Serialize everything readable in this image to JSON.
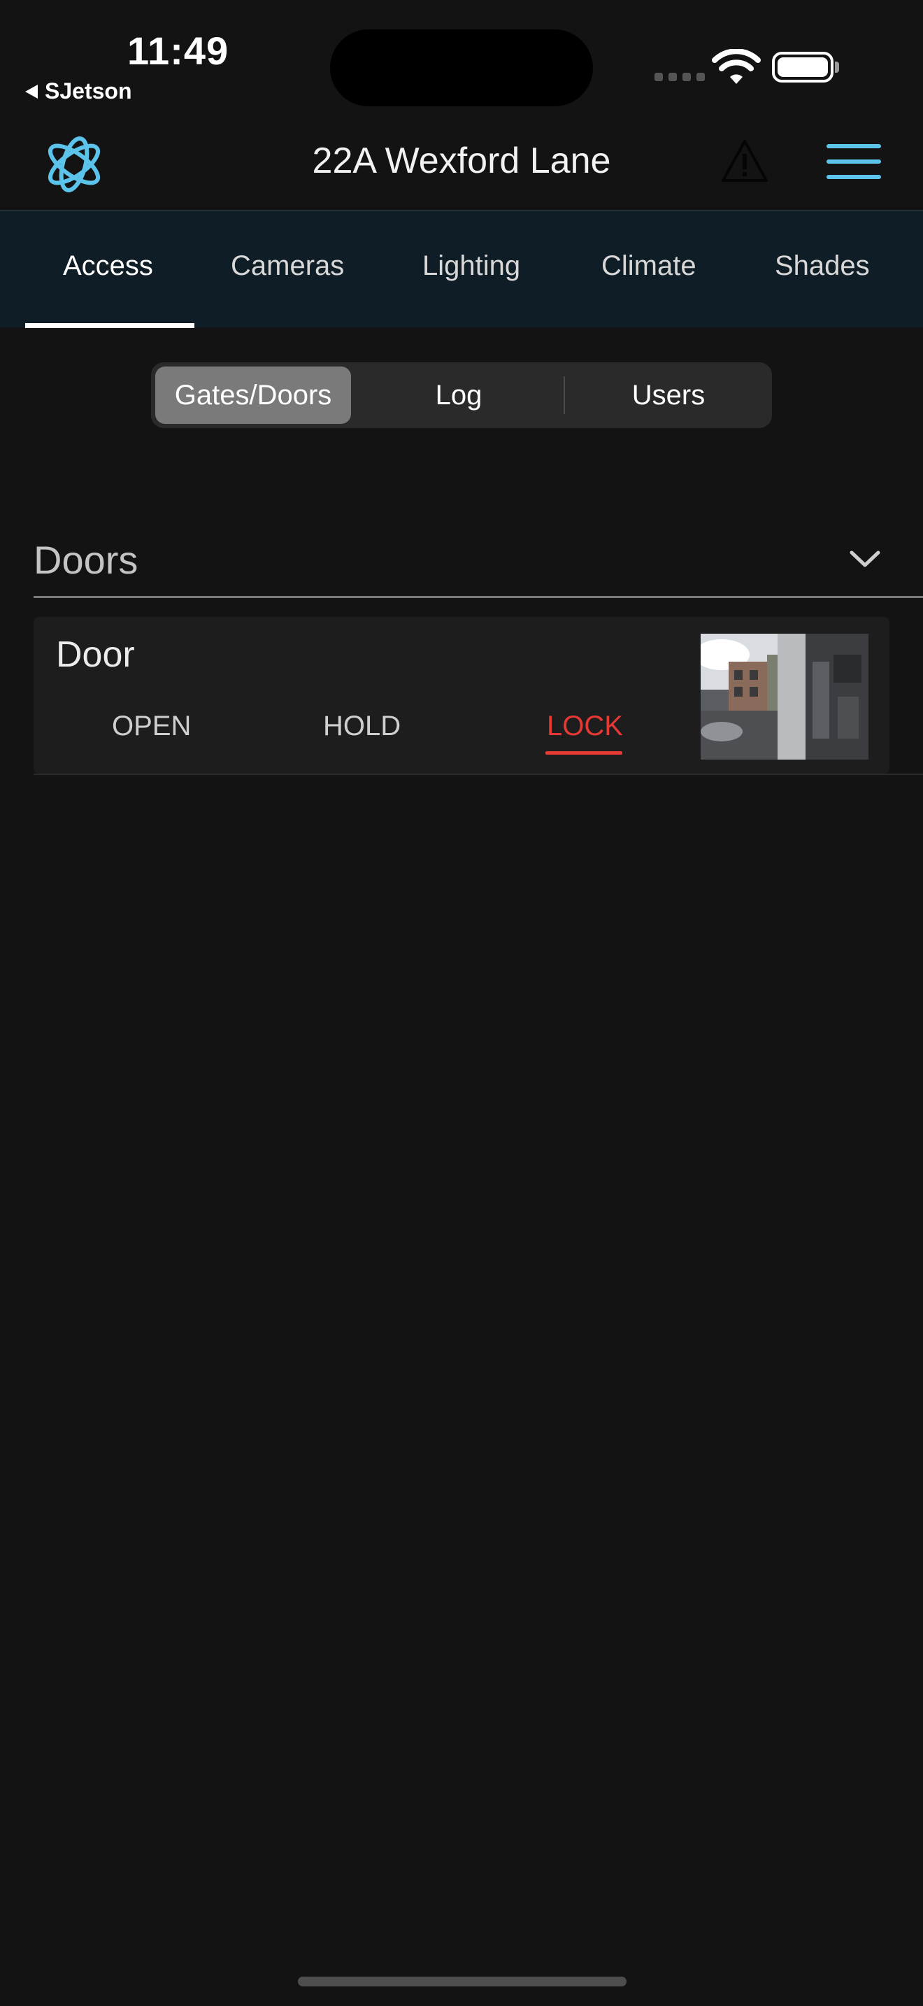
{
  "status_bar": {
    "time": "11:49",
    "back_label": "SJetson"
  },
  "header": {
    "title": "22A Wexford Lane",
    "logo_icon": "atom-logo-icon",
    "alert_icon": "warning-triangle-icon",
    "menu_icon": "hamburger-menu-icon",
    "accent_color": "#5cc3ea"
  },
  "tabs": [
    {
      "label": "Access",
      "active": true
    },
    {
      "label": "Cameras",
      "active": false
    },
    {
      "label": "Lighting",
      "active": false
    },
    {
      "label": "Climate",
      "active": false
    },
    {
      "label": "Shades",
      "active": false
    }
  ],
  "segmented": {
    "options": [
      "Gates/Doors",
      "Log",
      "Users"
    ],
    "selected": "Gates/Doors"
  },
  "section": {
    "title": "Doors",
    "chevron_icon": "chevron-down-icon"
  },
  "door": {
    "name": "Door",
    "actions": [
      "OPEN",
      "HOLD",
      "LOCK"
    ],
    "active_action": "LOCK",
    "active_color": "#e53935"
  }
}
